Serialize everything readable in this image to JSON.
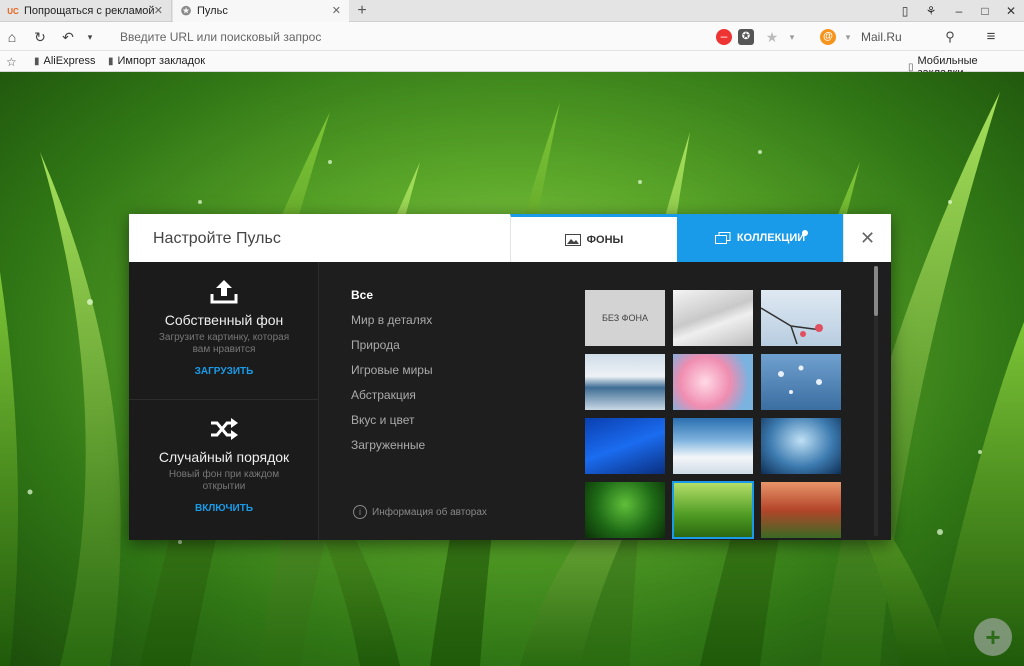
{
  "tabs": [
    {
      "icon": "uc-icon",
      "icon_text": "UC",
      "title": "Попрощаться с рекламой"
    },
    {
      "icon": "star-icon",
      "icon_text": "✪",
      "title": "Пульс"
    }
  ],
  "address_bar": {
    "placeholder": "Введите URL или поисковый запрос",
    "search_engine": "Mail.Ru"
  },
  "bookmarks": [
    {
      "label": "AliExpress"
    },
    {
      "label": "Импорт закладок"
    }
  ],
  "mobile_bookmarks": "Мобильные закладки",
  "dialog": {
    "title": "Настройте Пульс",
    "tab_backgrounds": "ФОНЫ",
    "tab_collections": "КОЛЛЕКЦИИ",
    "own_background": {
      "title": "Собственный фон",
      "description": "Загрузите картинку, которая вам нравится",
      "action": "ЗАГРУЗИТЬ"
    },
    "random_order": {
      "title": "Случайный порядок",
      "description": "Новый фон при каждом открытии",
      "action": "ВКЛЮЧИТЬ"
    },
    "categories": [
      {
        "label": "Все",
        "active": true
      },
      {
        "label": "Мир в деталях",
        "active": false
      },
      {
        "label": "Природа",
        "active": false
      },
      {
        "label": "Игровые миры",
        "active": false
      },
      {
        "label": "Абстракция",
        "active": false
      },
      {
        "label": "Вкус и цвет",
        "active": false
      },
      {
        "label": "Загруженные",
        "active": false
      }
    ],
    "author_info": "Информация об авторах",
    "no_background_label": "БЕЗ ФОНА",
    "accent_color": "#1a9be9"
  }
}
